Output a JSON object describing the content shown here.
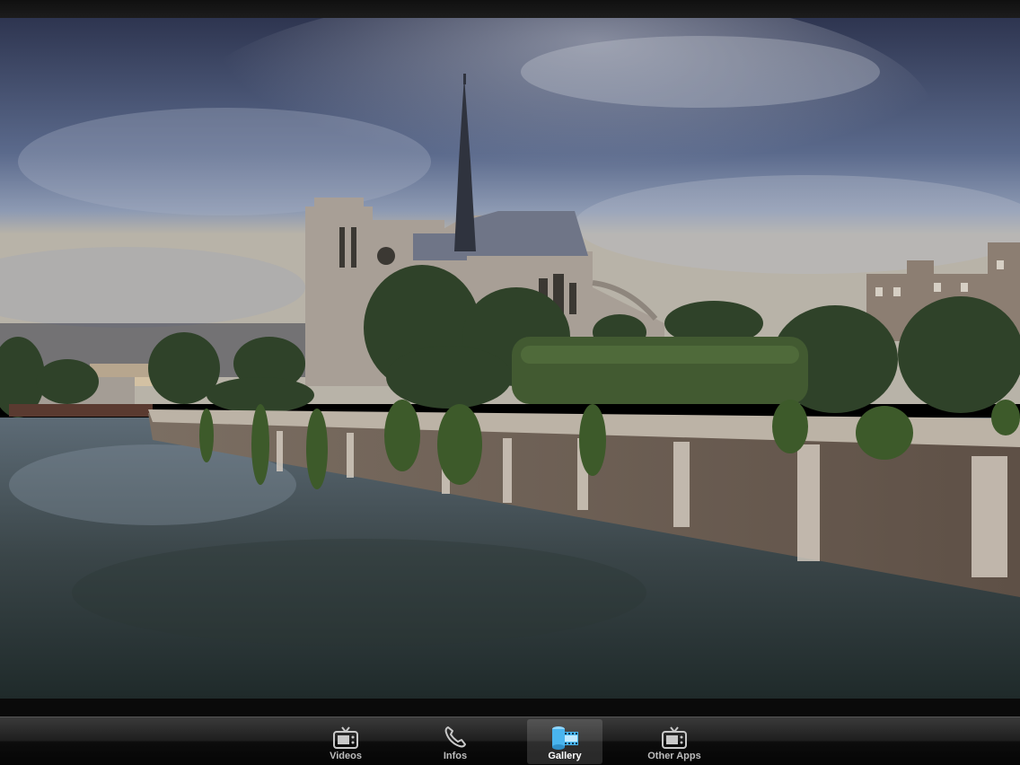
{
  "photo": {
    "subject": "photo-notre-dame-seine"
  },
  "tabbar": {
    "active": "gallery",
    "items": [
      {
        "id": "videos",
        "label": "Videos",
        "icon": "tv-icon"
      },
      {
        "id": "infos",
        "label": "Infos",
        "icon": "phone-icon"
      },
      {
        "id": "gallery",
        "label": "Gallery",
        "icon": "film-roll-icon"
      },
      {
        "id": "other-apps",
        "label": "Other Apps",
        "icon": "tv-icon"
      }
    ]
  },
  "colors": {
    "tabbar_bg": "#1a1a1a",
    "active_icon": "#49b5ef",
    "inactive_icon": "#c8c8c8",
    "label_inactive": "#bdbdbd",
    "label_active": "#ffffff"
  }
}
